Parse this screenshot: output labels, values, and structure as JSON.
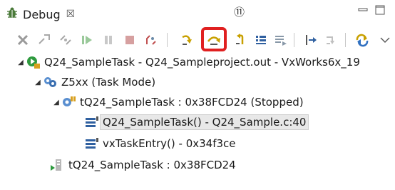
{
  "tab": {
    "title": "Debug",
    "close_glyph": "☒"
  },
  "callout": "⑪",
  "toolbar": {
    "buttons": [
      "remove-terminated-icon",
      "connect-icon",
      "disconnect-icon",
      "resume-icon",
      "suspend-icon",
      "terminate-icon",
      "disconnect-target-icon",
      "step-into-icon",
      "step-over-icon",
      "step-return-icon",
      "instruction-step-icon",
      "use-step-filters-icon",
      "step-into-selection-icon",
      "drop-to-frame-icon",
      "refresh-icon",
      "view-menu-icon"
    ],
    "highlighted": "step-over-icon"
  },
  "tree": {
    "rows": [
      {
        "label": "Q24_SampleTask - Q24_Sampleproject.out - VxWorks6x_19",
        "icon": "launch-icon"
      },
      {
        "label": "Z5xx (Task Mode)",
        "icon": "target-icon"
      },
      {
        "label": "tQ24_SampleTask : 0x38FCD24 (Stopped)",
        "icon": "task-icon"
      },
      {
        "label": "Q24_SampleTask() - Q24_Sample.c:40",
        "icon": "stack-frame-icon"
      },
      {
        "label": "vxTaskEntry() - 0x34f3ce",
        "icon": "stack-frame-icon"
      },
      {
        "label": "tQ24_SampleTask : 0x38FCD24",
        "icon": "task-running-icon"
      }
    ]
  },
  "colors": {
    "highlight": "#e02020",
    "selection": "#e8e8e8"
  }
}
